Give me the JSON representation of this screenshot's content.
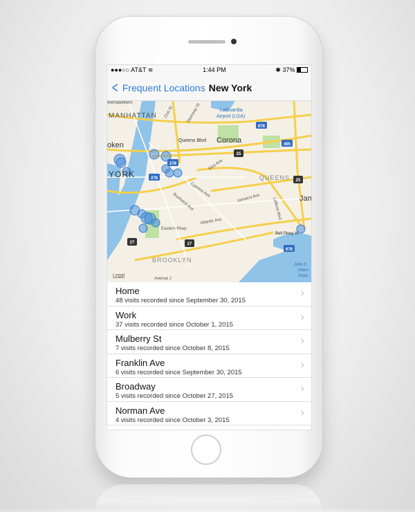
{
  "status": {
    "carrier": "●●●○○ AT&T",
    "time": "1:44 PM",
    "battery": "37%"
  },
  "nav": {
    "back_label": "Frequent Locations",
    "title": "New York"
  },
  "map": {
    "labels": [
      "MANHATTAN",
      "YORK",
      "oken",
      "Queens Blvd",
      "Corona",
      "LaGuardia",
      "Airport (LGA)",
      "QUEENS",
      "Jama",
      "Eliot Ave",
      "Cypress Ave",
      "Bushwick Ave",
      "Jamaica Ave",
      "Lefferts Blvd",
      "Atlantic Ave",
      "Eastern Pkwy",
      "Belt Pkwy W",
      "BROOKLYN",
      "Avenue J",
      "John F.",
      "Intern",
      "Airpo",
      "21st St",
      "Steinway St",
      "eehawken"
    ],
    "shields": [
      "278",
      "278",
      "678",
      "495",
      "25",
      "25",
      "27",
      "27",
      "678"
    ],
    "legal": "Legal"
  },
  "locations": [
    {
      "name": "Home",
      "sub": "48 visits recorded since September 30, 2015"
    },
    {
      "name": "Work",
      "sub": "37 visits recorded since October 1, 2015"
    },
    {
      "name": "Mulberry St",
      "sub": "7 visits recorded since October 8, 2015"
    },
    {
      "name": "Franklin Ave",
      "sub": "6 visits recorded since September 30, 2015"
    },
    {
      "name": "Broadway",
      "sub": "5 visits recorded since October 27, 2015"
    },
    {
      "name": "Norman Ave",
      "sub": "4 visits recorded since October 3, 2015"
    }
  ],
  "colors": {
    "accent": "#2f7dd9",
    "road": "#f5cf4a",
    "water": "#8fc3e8",
    "park": "#bfe1a4",
    "land": "#f4f0e6"
  }
}
